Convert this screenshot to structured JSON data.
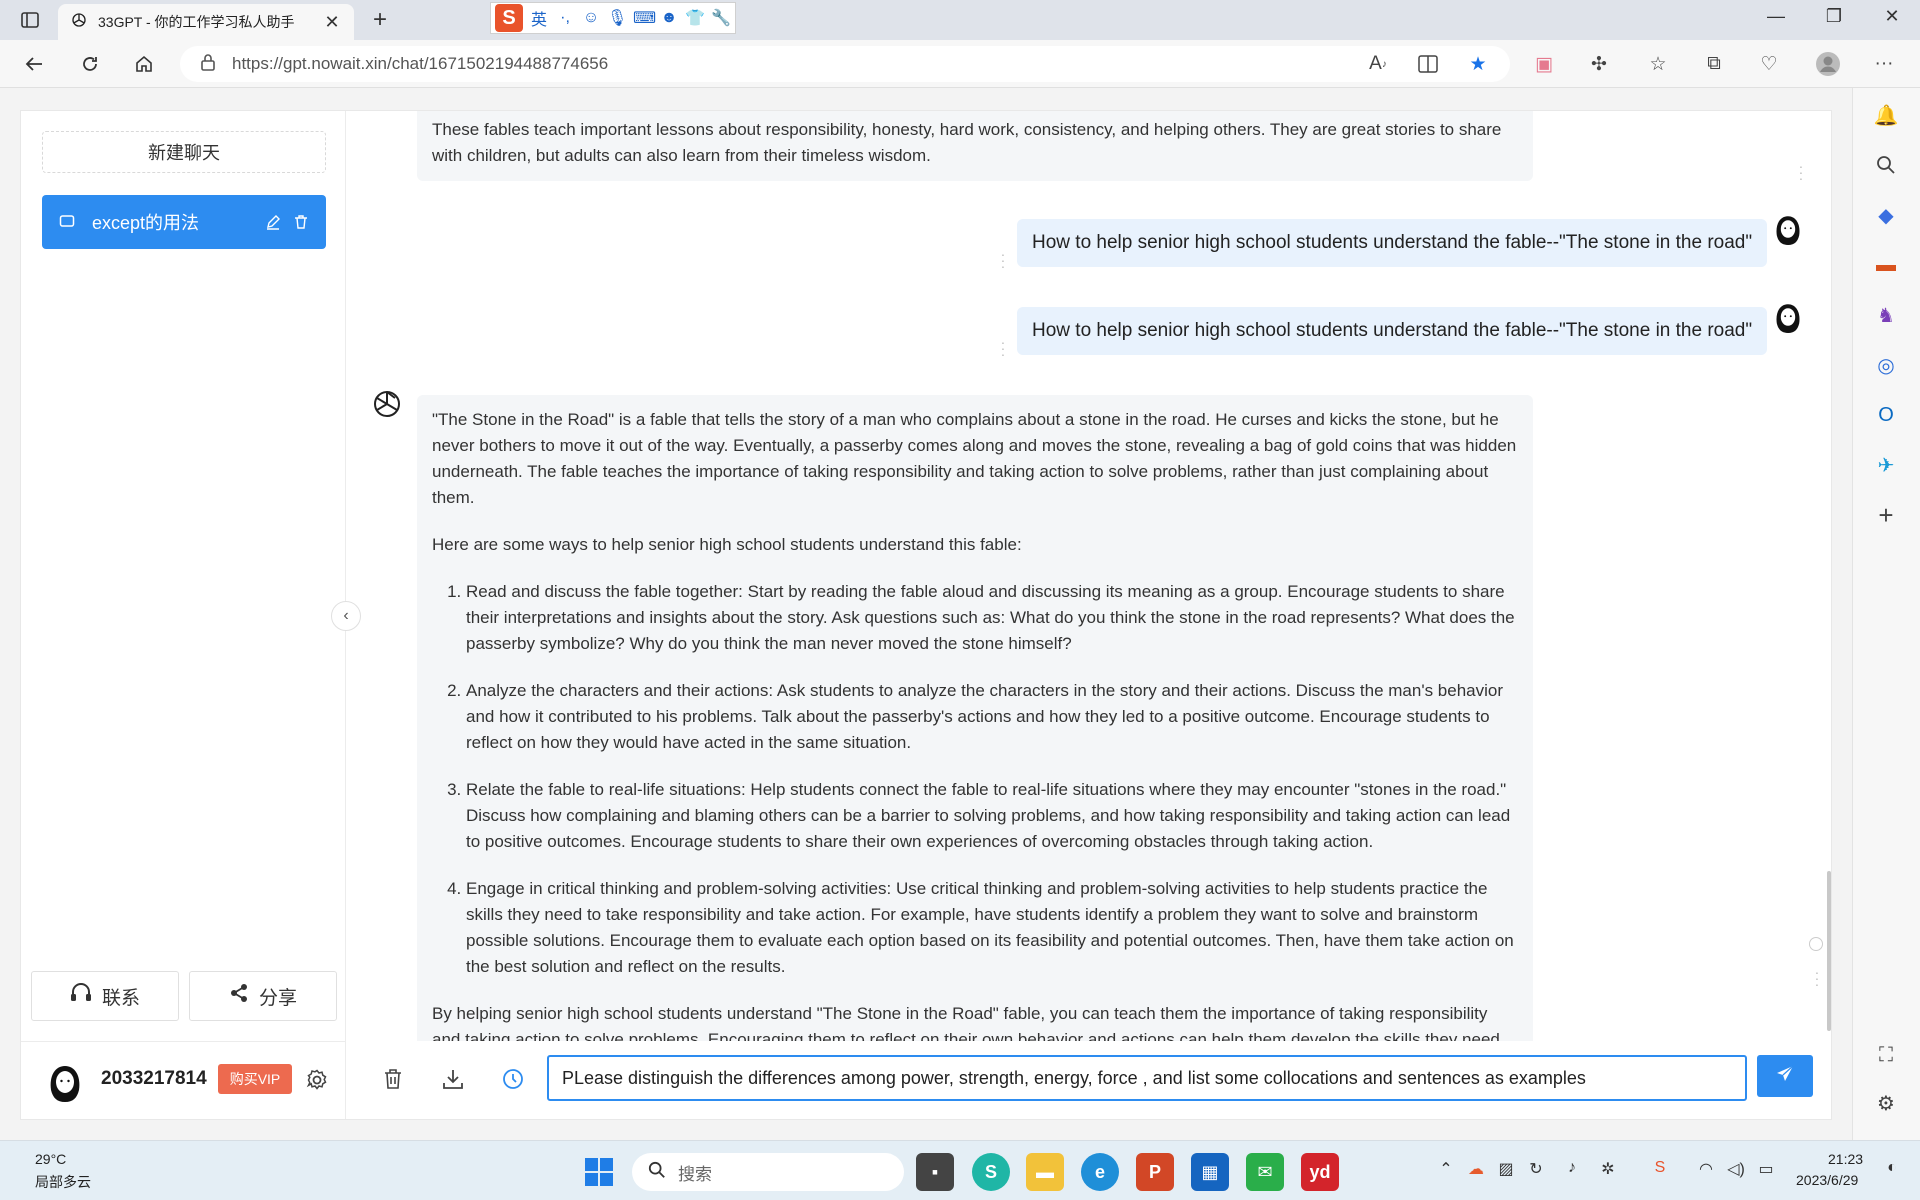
{
  "browser": {
    "tab_title": "33GPT - 你的工作学习私人助手",
    "tab_close": "✕",
    "new_tab": "+",
    "ime_lang": "英",
    "url": "https://gpt.nowait.xin/chat/1671502194488774656",
    "window_controls": [
      "—",
      "❐",
      "✕"
    ]
  },
  "sidebar": {
    "new_chat_label": "新建聊天",
    "chats": [
      {
        "label": "except的用法"
      }
    ],
    "contact_label": "联系",
    "share_label": "分享",
    "user_id": "2033217814",
    "vip_label": "购买VIP"
  },
  "conversation": {
    "ai_prev_text": "These fables teach important lessons about responsibility, honesty, hard work, consistency, and helping others. They are great stories to share with children, but adults can also learn from their timeless wisdom.",
    "user_messages": [
      "How to help senior high school students understand the fable--\"The stone in the road\"",
      "How to help senior high school students understand the fable--\"The stone in the road\""
    ],
    "ai_answer": {
      "intro": "\"The Stone in the Road\" is a fable that tells the story of a man who complains about a stone in the road. He curses and kicks the stone, but he never bothers to move it out of the way. Eventually, a passerby comes along and moves the stone, revealing a bag of gold coins that was hidden underneath. The fable teaches the importance of taking responsibility and taking action to solve problems, rather than just complaining about them.",
      "lead": "Here are some ways to help senior high school students understand this fable:",
      "items": [
        "Read and discuss the fable together: Start by reading the fable aloud and discussing its meaning as a group. Encourage students to share their interpretations and insights about the story. Ask questions such as: What do you think the stone in the road represents? What does the passerby symbolize? Why do you think the man never moved the stone himself?",
        "Analyze the characters and their actions: Ask students to analyze the characters in the story and their actions. Discuss the man's behavior and how it contributed to his problems. Talk about the passerby's actions and how they led to a positive outcome. Encourage students to reflect on how they would have acted in the same situation.",
        "Relate the fable to real-life situations: Help students connect the fable to real-life situations where they may encounter \"stones in the road.\" Discuss how complaining and blaming others can be a barrier to solving problems, and how taking responsibility and taking action can lead to positive outcomes. Encourage students to share their own experiences of overcoming obstacles through taking action.",
        "Engage in critical thinking and problem-solving activities: Use critical thinking and problem-solving activities to help students practice the skills they need to take responsibility and take action. For example, have students identify a problem they want to solve and brainstorm possible solutions. Encourage them to evaluate each option based on its feasibility and potential outcomes. Then, have them take action on the best solution and reflect on the results."
      ],
      "conclusion": "By helping senior high school students understand \"The Stone in the Road\" fable, you can teach them the importance of taking responsibility and taking action to solve problems. Encouraging them to reflect on their own behavior and actions can help them develop the skills they need to be successful in school and in life."
    }
  },
  "input": {
    "value": "PLease distinguish the differences among power, strength, energy, force , and list some collocations and sentences as examples"
  },
  "taskbar": {
    "weather_temp": "29°C",
    "weather_desc": "局部多云",
    "search_label": "搜索",
    "time": "21:23",
    "date": "2023/6/29"
  },
  "colors": {
    "accent": "#2d8cf0",
    "vip": "#ed6a4f",
    "user_bubble": "#e8f2fd",
    "ai_bubble": "#f4f6f8"
  },
  "icons": [
    "tab-actions-icon",
    "openai-icon",
    "back-icon",
    "refresh-icon",
    "home-icon",
    "lock-icon",
    "read-aloud-icon",
    "split-screen-icon",
    "favorite-star-icon",
    "extensions-icon",
    "favorites-icon",
    "collections-icon",
    "performance-icon",
    "profile-icon",
    "more-icon",
    "chat-bubble-icon",
    "edit-icon",
    "trash-icon",
    "headset-icon",
    "share-icon",
    "settings-icon",
    "chevron-left-icon",
    "clear-icon",
    "download-icon",
    "history-icon",
    "send-icon",
    "windows-start-icon",
    "search-icon"
  ]
}
